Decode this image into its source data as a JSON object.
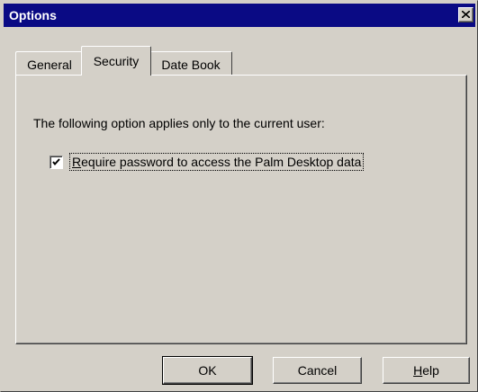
{
  "window": {
    "title": "Options",
    "close_icon": "close-x-icon"
  },
  "tabs": [
    {
      "label": "General",
      "selected": false
    },
    {
      "label": "Security",
      "selected": true
    },
    {
      "label": "Date Book",
      "selected": false
    }
  ],
  "security_panel": {
    "info_text": "The following option applies only to the current user:",
    "require_password": {
      "mnemonic": "R",
      "label_rest": "equire password to access the Palm Desktop data",
      "checked": true
    }
  },
  "buttons": {
    "ok": "OK",
    "cancel": "Cancel",
    "help_mnemonic": "H",
    "help_rest": "elp"
  },
  "colors": {
    "title_bar": "#0a0a84",
    "face": "#d4d0c8"
  }
}
